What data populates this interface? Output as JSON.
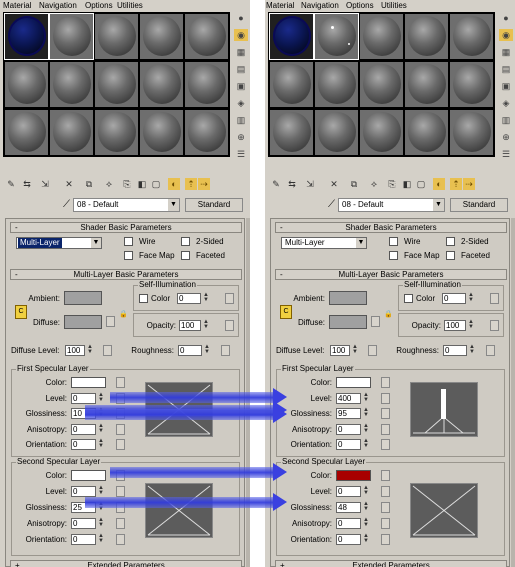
{
  "menu": [
    "Material",
    "Navigation",
    "Options",
    "Utilities"
  ],
  "material_name": "08 - Default",
  "material_type_button": "Standard",
  "shader_rollout": {
    "title": "Shader Basic Parameters",
    "shader_value": "Multi-Layer",
    "wire": "Wire",
    "two_sided": "2-Sided",
    "face_map": "Face Map",
    "faceted": "Faceted"
  },
  "multilayer_rollout": {
    "title": "Multi-Layer Basic Parameters",
    "ambient": "Ambient:",
    "diffuse": "Diffuse:",
    "self_illum_title": "Self-Illumination",
    "color_label": "Color",
    "self_illum_value": "0",
    "opacity": "Opacity:",
    "opacity_value": "100",
    "diffuse_level": "Diffuse Level:",
    "diffuse_level_value": "100",
    "roughness": "Roughness:",
    "roughness_value": "0"
  },
  "first_layer": {
    "title": "First Specular Layer",
    "color": "Color:",
    "level": "Level:",
    "glossiness": "Glossiness:",
    "anisotropy": "Anisotropy:",
    "orientation": "Orientation:"
  },
  "second_layer": {
    "title": "Second Specular Layer",
    "color": "Color:",
    "level": "Level:",
    "glossiness": "Glossiness:",
    "anisotropy": "Anisotropy:",
    "orientation": "Orientation:"
  },
  "extended_rollout": "Extended Parameters",
  "left_values": {
    "l1_level": "0",
    "l1_gloss": "10",
    "l1_aniso": "0",
    "l1_orient": "0",
    "l2_level": "0",
    "l2_gloss": "25",
    "l2_aniso": "0",
    "l2_orient": "0"
  },
  "right_values": {
    "l1_level": "400",
    "l1_gloss": "95",
    "l1_aniso": "0",
    "l1_orient": "0",
    "l2_level": "0",
    "l2_gloss": "48",
    "l2_aniso": "0",
    "l2_orient": "0"
  },
  "colors": {
    "left_l1_color": "#ffffff",
    "left_l2_color": "#ffffff",
    "right_l1_color": "#ffffff",
    "right_l2_color": "#a80000",
    "ambient": "#a0a0a0",
    "arrow": "#3a40e0"
  }
}
